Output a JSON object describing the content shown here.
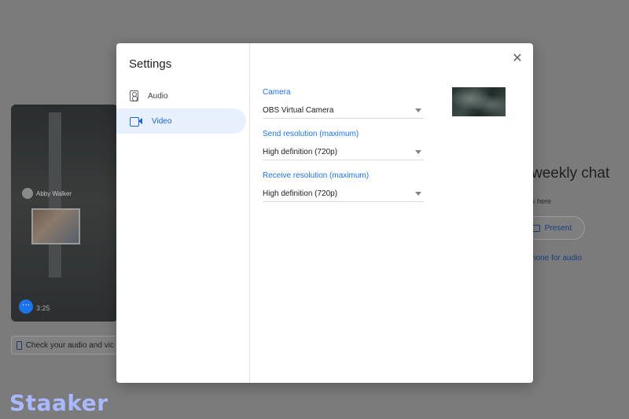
{
  "background": {
    "check_audio_label": "Check your audio and vic",
    "meeting_title": "weekly chat",
    "meeting_subtitle": "s here",
    "present_label": "Present",
    "phone_audio_label": "hone for audio",
    "preview_name_tag": "Abby Walker",
    "preview_timestamp": "3:25"
  },
  "dialog": {
    "title": "Settings",
    "nav": [
      {
        "label": "Audio",
        "icon": "speaker-icon",
        "selected": false
      },
      {
        "label": "Video",
        "icon": "videocam-icon",
        "selected": true
      }
    ],
    "close_icon": "close-icon",
    "fields": {
      "camera": {
        "label": "Camera",
        "value": "OBS Virtual Camera"
      },
      "send_resolution": {
        "label": "Send resolution (maximum)",
        "value": "High definition (720p)"
      },
      "receive_resolution": {
        "label": "Receive resolution (maximum)",
        "value": "High definition (720p)"
      }
    }
  },
  "watermark": "Staaker",
  "colors": {
    "accent": "#1a73e8",
    "nav_selected_bg": "#e8f0fe",
    "overlay": "#7b7b7b",
    "watermark": "#a9b8ff"
  }
}
